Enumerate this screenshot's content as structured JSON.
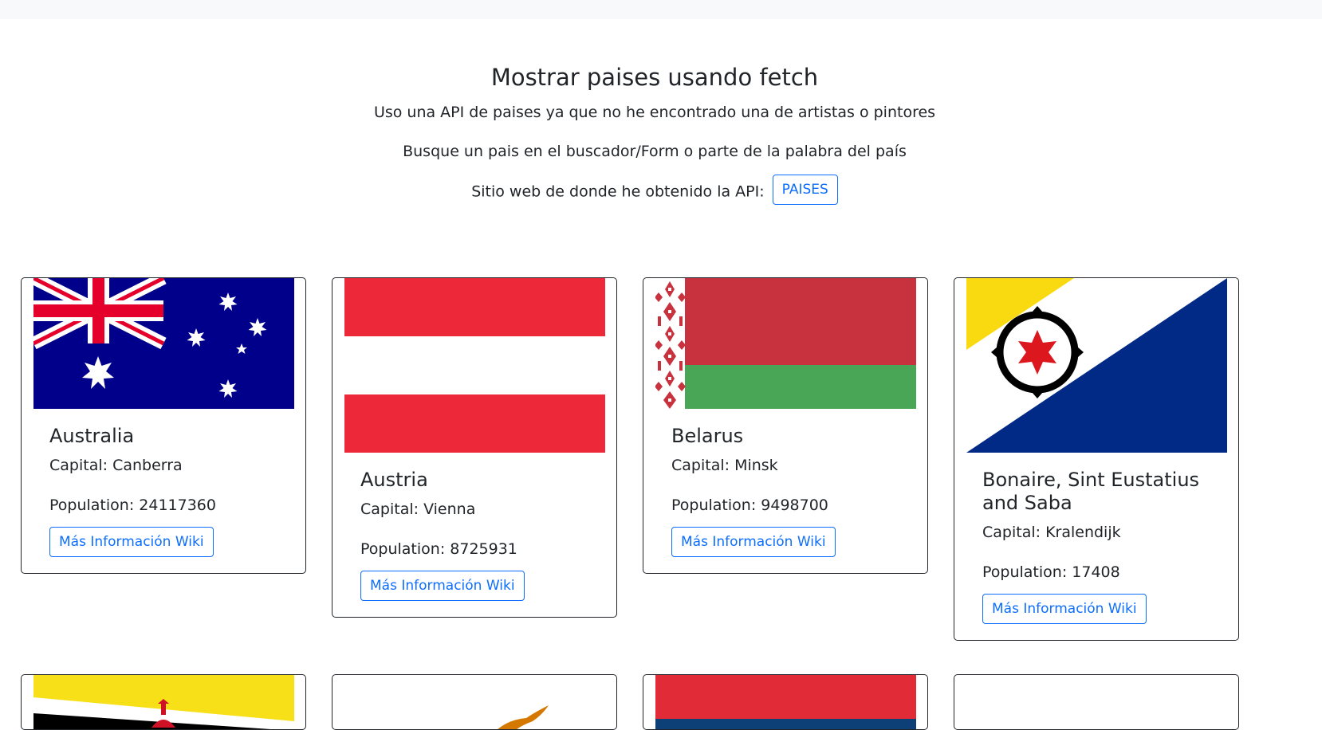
{
  "header": {
    "title": "Mostrar paises usando fetch",
    "subtitle": "Uso una API de paises ya que no he encontrado una de artistas o pintores",
    "instructions": "Busque un pais en el buscador/Form o parte de la palabra del país",
    "source_text": "Sitio web de donde he obtenido la API:",
    "source_button": "PAISES"
  },
  "labels": {
    "capital": "Capital: ",
    "population": "Population: "
  },
  "countries": [
    {
      "name": "Australia",
      "capital": "Canberra",
      "population": "24117360",
      "wiki_label": "Más Información Wiki"
    },
    {
      "name": "Austria",
      "capital": "Vienna",
      "population": "8725931",
      "wiki_label": "Más Información Wiki"
    },
    {
      "name": "Belarus",
      "capital": "Minsk",
      "population": "9498700",
      "wiki_label": "Más Información Wiki"
    },
    {
      "name": "Bonaire, Sint Eustatius and Saba",
      "capital": "Kralendijk",
      "population": "17408",
      "wiki_label": "Más Información Wiki"
    }
  ],
  "colors": {
    "primary": "#0d6efd",
    "australia_blue": "#00008b",
    "austria_red": "#ed2939",
    "belarus_red": "#c8313e",
    "belarus_green": "#4aa657",
    "bonaire_blue": "#012a87",
    "bonaire_yellow": "#f9d90f",
    "bonaire_red": "#dc171d",
    "brunei_yellow": "#f7e017",
    "cyprus_copper": "#d57800",
    "serbia_blue": "#0c4076"
  }
}
